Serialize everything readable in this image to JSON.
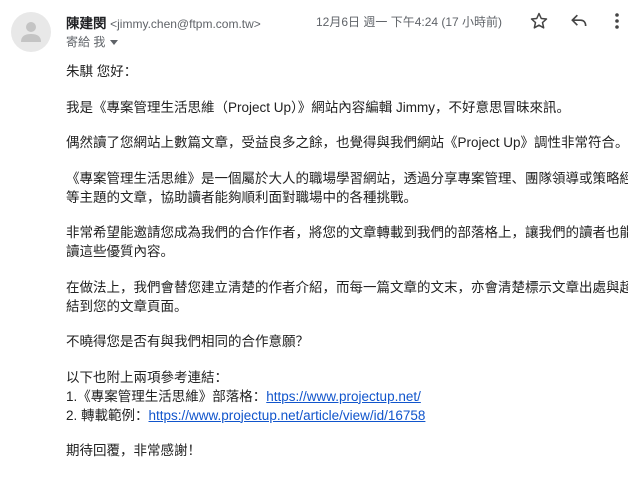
{
  "header": {
    "sender_name": "陳建閔",
    "sender_email": "<jimmy.chen@ftpm.com.tw>",
    "to_label": "寄給 我",
    "date": "12月6日 週一 下午4:24 (17 小時前)"
  },
  "body": {
    "greeting": "朱騏 您好：",
    "p1": "我是《專案管理生活思維（Project Up）》網站內容編輯 Jimmy，不好意思冒昧來訊。",
    "p2": "偶然讀了您網站上數篇文章，受益良多之餘，也覺得與我們網站《Project Up》調性非常符合。",
    "p3_l1": "《專案管理生活思維》是一個屬於大人的職場學習網站，透過分享專案管理、團隊領導或策略經營",
    "p3_l2": "等主題的文章，協助讀者能夠順利面對職場中的各種挑戰。",
    "p4_l1": "非常希望能邀請您成為我們的合作作者，將您的文章轉載到我們的部落格上，讓我們的讀者也能一",
    "p4_l2": "讀這些優質內容。",
    "p5_l1": "在做法上，我們會替您建立清楚的作者介紹，而每一篇文章的文末，亦會清楚標示文章出處與超連",
    "p5_l2": "結到您的文章頁面。",
    "p6": "不曉得您是否有與我們相同的合作意願？",
    "p7_intro": "以下也附上兩項參考連結：",
    "link1_label": "1.《專案管理生活思維》部落格：",
    "link1_url": "https://www.projectup.net/",
    "link2_label": "2. 轉載範例：",
    "link2_url": "https://www.projectup.net/article/view/id/16758",
    "closing": "期待回覆，非常感謝！"
  },
  "colors": {
    "link": "#1155cc",
    "meta": "#5f6368"
  }
}
